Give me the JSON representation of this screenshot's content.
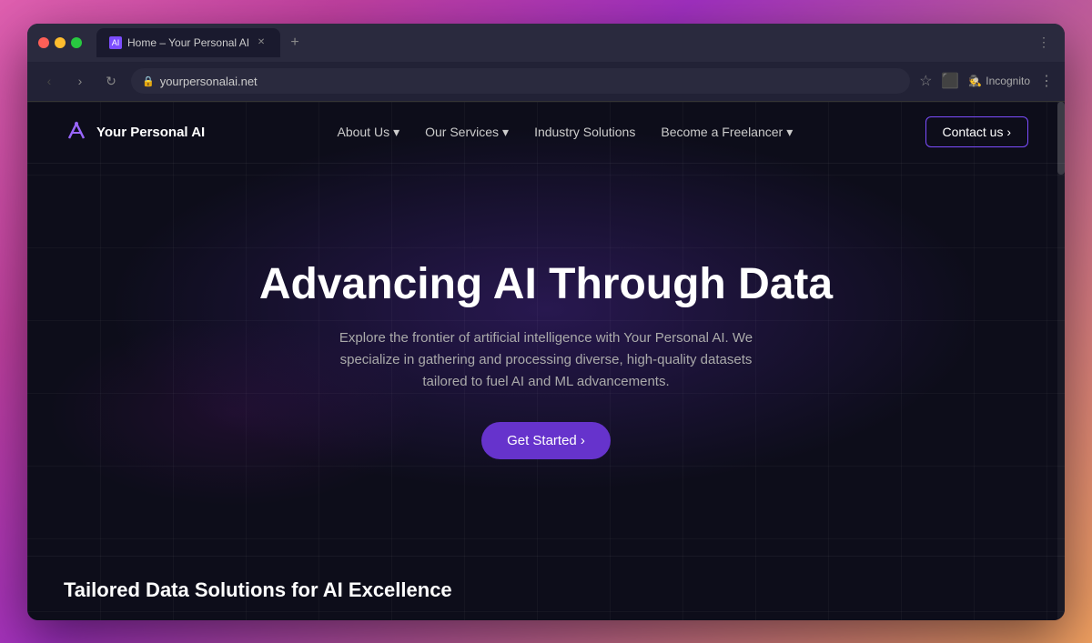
{
  "browser": {
    "tab_title": "Home – Your Personal AI",
    "url": "yourpersonalai.net",
    "incognito_label": "Incognito"
  },
  "navbar": {
    "logo_text": "Your Personal AI",
    "nav_about": "About Us",
    "nav_services": "Our Services",
    "nav_industry": "Industry Solutions",
    "nav_freelancer": "Become a Freelancer",
    "cta_label": "Contact us ›"
  },
  "hero": {
    "title": "Advancing AI Through Data",
    "subtitle": "Explore the frontier of artificial intelligence with Your Personal AI. We specialize in gathering and processing diverse, high-quality datasets tailored to fuel AI and ML advancements.",
    "cta_label": "Get Started ›"
  },
  "bottom": {
    "title": "Tailored Data Solutions for AI Excellence"
  },
  "icons": {
    "back": "‹",
    "forward": "›",
    "reload": "↻",
    "lock": "🔒",
    "bookmark": "☆",
    "extensions": "⬛",
    "kebab": "⋮",
    "chevron_down": "▾",
    "arrow_right": "›"
  }
}
